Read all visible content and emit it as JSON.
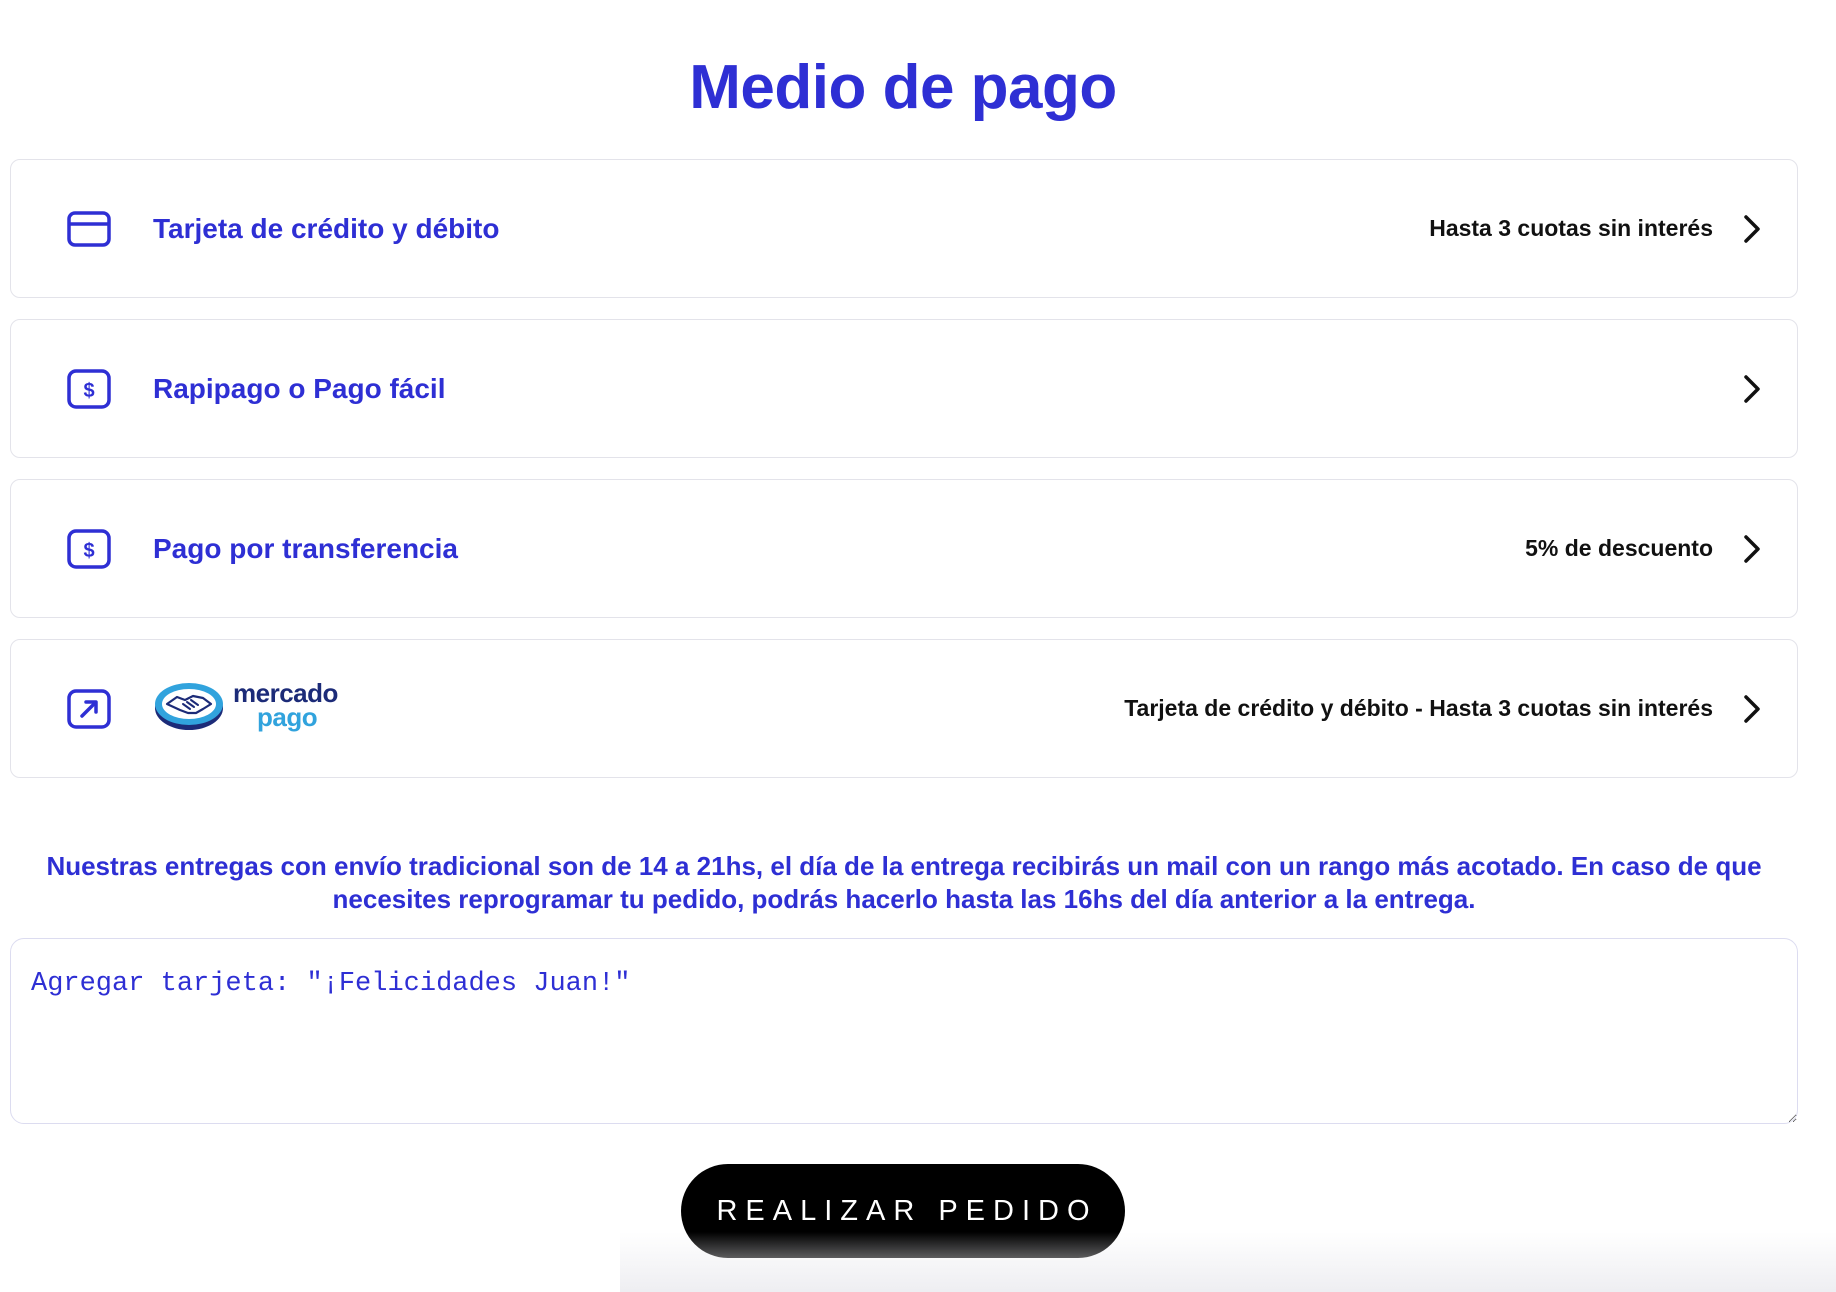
{
  "page": {
    "title": "Medio de pago"
  },
  "payment_methods": [
    {
      "id": "card",
      "icon": "credit-card-icon",
      "label": "Tarjeta de crédito y débito",
      "note": "Hasta 3 cuotas sin interés"
    },
    {
      "id": "rapipago",
      "icon": "dollar-square-icon",
      "label": "Rapipago o Pago fácil",
      "note": ""
    },
    {
      "id": "transfer",
      "icon": "dollar-square-icon",
      "label": "Pago por transferencia",
      "note": "5% de descuento"
    },
    {
      "id": "mercadopago",
      "icon": "external-link-arrow-icon",
      "logo_words": [
        "mercado",
        "pago"
      ],
      "note": "Tarjeta de crédito y débito - Hasta 3 cuotas sin interés"
    }
  ],
  "delivery_note": "Nuestras entregas con envío tradicional son de 14 a 21hs, el día de la entrega recibirás un mail con un rango más acotado. En caso de que necesites reprogramar tu pedido, podrás hacerlo hasta las 16hs del día anterior a la entrega.",
  "card_message": {
    "placeholder": "Agregar tarjeta: \"¡Felicidades Juan!\"",
    "value": ""
  },
  "submit": {
    "label": "REALIZAR PEDIDO"
  },
  "colors": {
    "accent": "#2e2fd4",
    "button_bg": "#000000",
    "border": "#e3e3ea",
    "mercadopago_dark": "#1c2b78",
    "mercadopago_light": "#31a3dd"
  }
}
